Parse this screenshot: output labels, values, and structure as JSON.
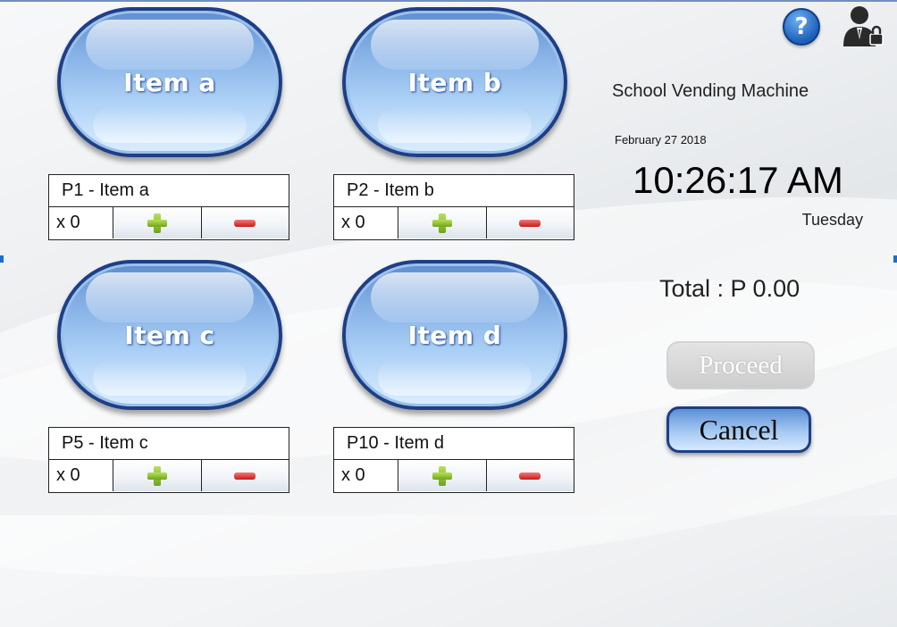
{
  "items": [
    {
      "button_label": "Item a",
      "code_name": "P1  -  Item a",
      "qty": "x 0"
    },
    {
      "button_label": "Item b",
      "code_name": "P2  -  Item b",
      "qty": "x 0"
    },
    {
      "button_label": "Item c",
      "code_name": "P5  -  Item c",
      "qty": "x 0"
    },
    {
      "button_label": "Item d",
      "code_name": "P10  -  Item d",
      "qty": "x 0"
    }
  ],
  "header": {
    "app_title": "School Vending Machine",
    "date": "February 27 2018",
    "time": "10:26:17 AM",
    "day": "Tuesday",
    "help_label": "?"
  },
  "summary": {
    "total": "Total : P 0.00"
  },
  "actions": {
    "proceed_label": "Proceed",
    "proceed_enabled": false,
    "cancel_label": "Cancel"
  },
  "icons": {
    "help": "help-icon",
    "admin": "admin-user-lock-icon",
    "plus": "plus-icon",
    "minus": "minus-icon"
  },
  "colors": {
    "button_blue": "#86b1e6",
    "button_border": "#1d3f86",
    "plus_green": "#6ea51c",
    "minus_red": "#c81a1a"
  }
}
